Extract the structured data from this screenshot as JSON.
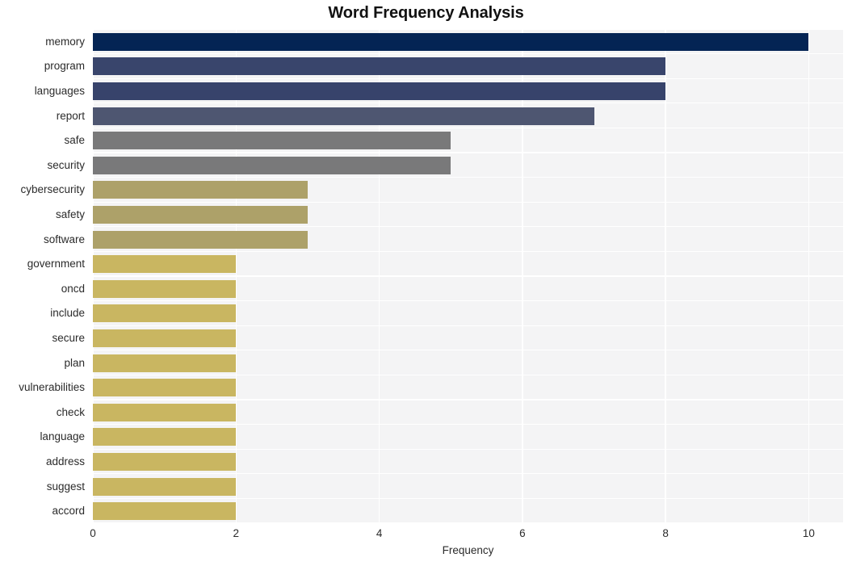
{
  "chart_data": {
    "type": "bar",
    "orientation": "horizontal",
    "title": "Word Frequency Analysis",
    "xlabel": "Frequency",
    "ylabel": "",
    "categories": [
      "memory",
      "program",
      "languages",
      "report",
      "safe",
      "security",
      "cybersecurity",
      "safety",
      "software",
      "government",
      "oncd",
      "include",
      "secure",
      "plan",
      "vulnerabilities",
      "check",
      "language",
      "address",
      "suggest",
      "accord"
    ],
    "values": [
      10,
      8,
      8,
      7,
      5,
      5,
      3,
      3,
      3,
      2,
      2,
      2,
      2,
      2,
      2,
      2,
      2,
      2,
      2,
      2
    ],
    "bar_colors": [
      "#042454",
      "#39456c",
      "#37436b",
      "#4e5671",
      "#79797a",
      "#79797a",
      "#ada169",
      "#ada169",
      "#ada169",
      "#c9b661",
      "#c9b661",
      "#c9b661",
      "#c9b661",
      "#c9b661",
      "#c9b661",
      "#c9b661",
      "#c9b661",
      "#c9b661",
      "#c9b661",
      "#c9b661"
    ],
    "xlim": [
      0,
      10.48
    ],
    "xticks": [
      0,
      2,
      4,
      6,
      8,
      10
    ],
    "xtick_labels": [
      "0",
      "2",
      "4",
      "6",
      "8",
      "10"
    ],
    "grid": true,
    "grid_color": "#ffffff",
    "plot_background": "#f4f4f5",
    "figure_background": "#ffffff",
    "legend": null
  }
}
